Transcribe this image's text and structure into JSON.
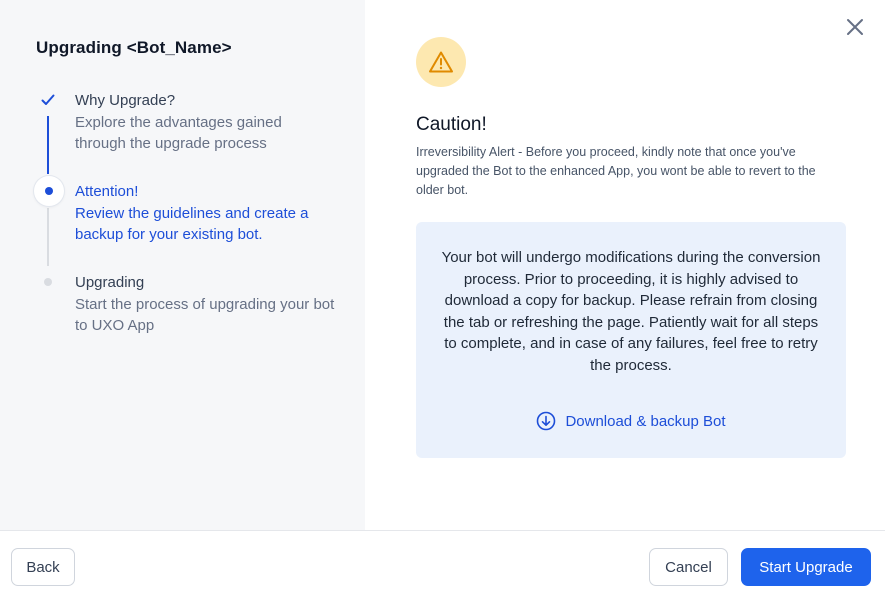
{
  "modal": {
    "title": "Upgrading <Bot_Name>"
  },
  "steps": [
    {
      "title": "Why Upgrade?",
      "description": "Explore the advantages gained through the upgrade process",
      "status": "completed"
    },
    {
      "title": "Attention!",
      "description": "Review the guidelines and create a backup for your existing bot.",
      "status": "current"
    },
    {
      "title": "Upgrading",
      "description": "Start the process of upgrading your bot to UXO App",
      "status": "pending"
    }
  ],
  "content": {
    "icon": "warning-triangle-icon",
    "heading": "Caution!",
    "alert_text": "Irreversibility Alert - Before you proceed, kindly note that once you've upgraded the Bot to the enhanced App, you wont be able to revert to the older bot.",
    "info_text": "Your bot will undergo modifications during the conversion process. Prior to proceeding, it is highly advised to download a copy for backup. Please refrain from closing the tab or refreshing the page. Patiently wait for all steps to complete, and in case of any failures, feel free to retry the process.",
    "download_label": "Download & backup Bot"
  },
  "footer": {
    "back_label": "Back",
    "cancel_label": "Cancel",
    "start_label": "Start Upgrade"
  },
  "colors": {
    "accent": "#1d4ed8",
    "primary_button": "#1e63ec",
    "warning_bg": "#fde8b0",
    "warning_icon": "#e08a00",
    "info_bg": "#eaf1fc",
    "panel_bg": "#f6f7f9"
  }
}
